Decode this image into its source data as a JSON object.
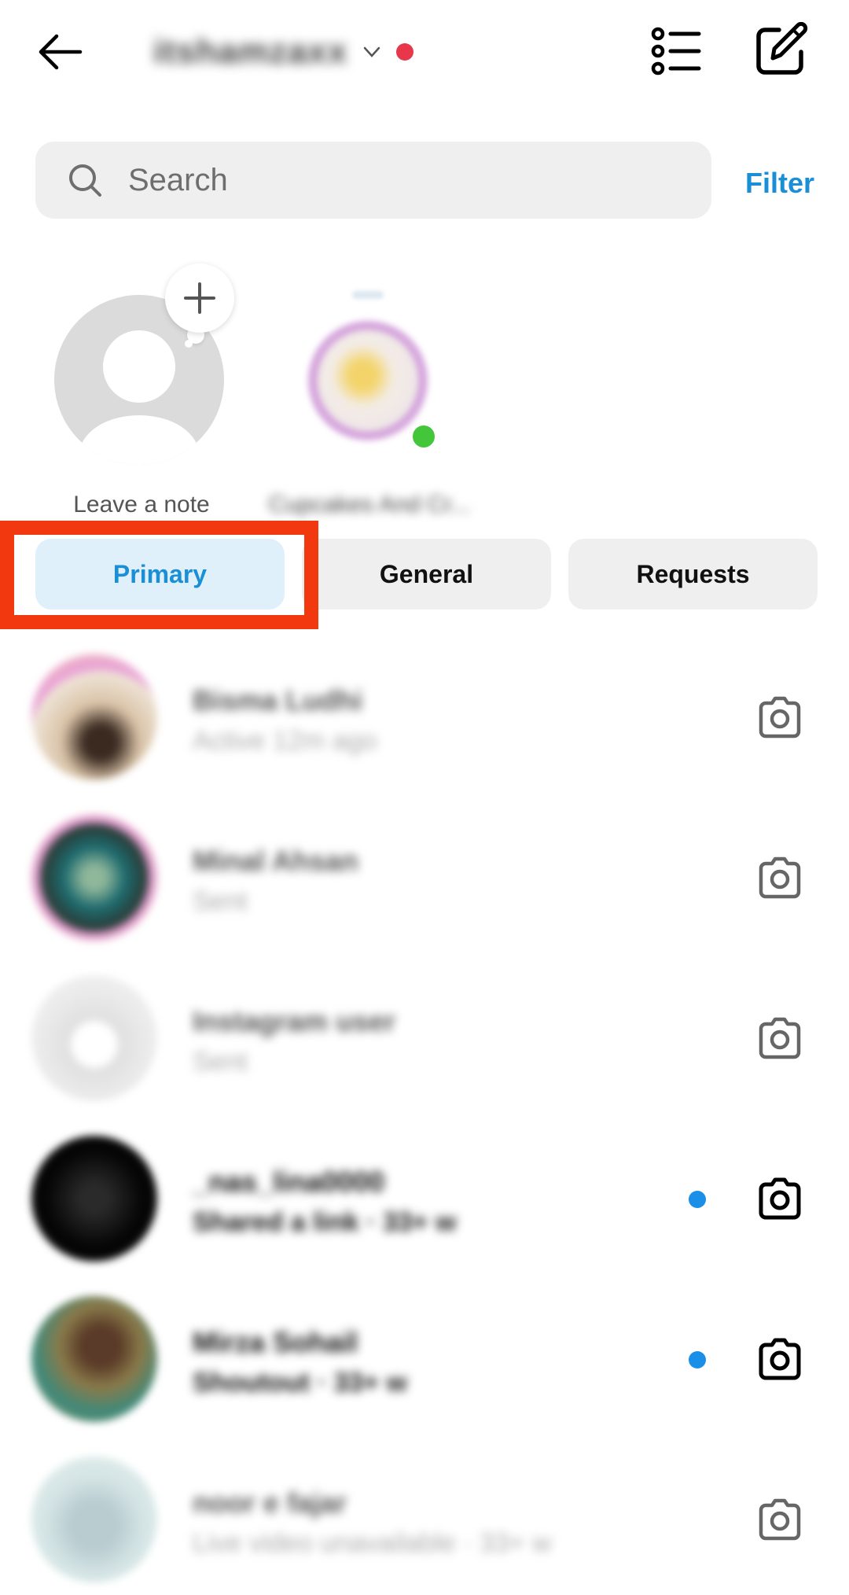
{
  "header": {
    "account_name": "itshamzaxx",
    "back_icon": "arrow-left-icon",
    "dropdown_icon": "chevron-down-icon",
    "notification_dot_color": "#e8364a",
    "list_icon": "list-icon",
    "compose_icon": "edit-icon"
  },
  "search": {
    "placeholder": "Search",
    "value": "",
    "icon": "search-icon"
  },
  "filter_label": "Filter",
  "notes": {
    "mine": {
      "label": "Leave a note",
      "action_icon": "plus-icon"
    },
    "friends": [
      {
        "label": "Cupcakes And Cr...",
        "online": true
      }
    ]
  },
  "tabs": [
    {
      "label": "Primary",
      "active": true
    },
    {
      "label": "General",
      "active": false
    },
    {
      "label": "Requests",
      "active": false
    }
  ],
  "highlight": {
    "target": "Primary",
    "color": "#f2380f"
  },
  "threads": [
    {
      "name": "Bisma Ludhi",
      "subtitle": "Active 12m ago",
      "unread": false,
      "badge": "pink-heart"
    },
    {
      "name": "Minal Ahsan",
      "subtitle": "Sent",
      "unread": false,
      "badge": "verified"
    },
    {
      "name": "Instagram user",
      "subtitle": "Sent",
      "unread": false,
      "badge": ""
    },
    {
      "name": "_nas_lina0000",
      "subtitle": "Shared a link · 33+ w",
      "unread": true,
      "badge": ""
    },
    {
      "name": "Mirza Sohail",
      "subtitle": "Shoutout · 33+ w",
      "unread": true,
      "badge": ""
    },
    {
      "name": "noor e fajar",
      "subtitle": "Live video unavailable · 33+ w",
      "unread": false,
      "badge": ""
    }
  ],
  "colors": {
    "accent": "#1a8fd6",
    "unread_dot": "#1a8fe8",
    "online": "#44c63a",
    "tab_bg": "#efefef",
    "tab_active_bg": "#dff0fb"
  }
}
